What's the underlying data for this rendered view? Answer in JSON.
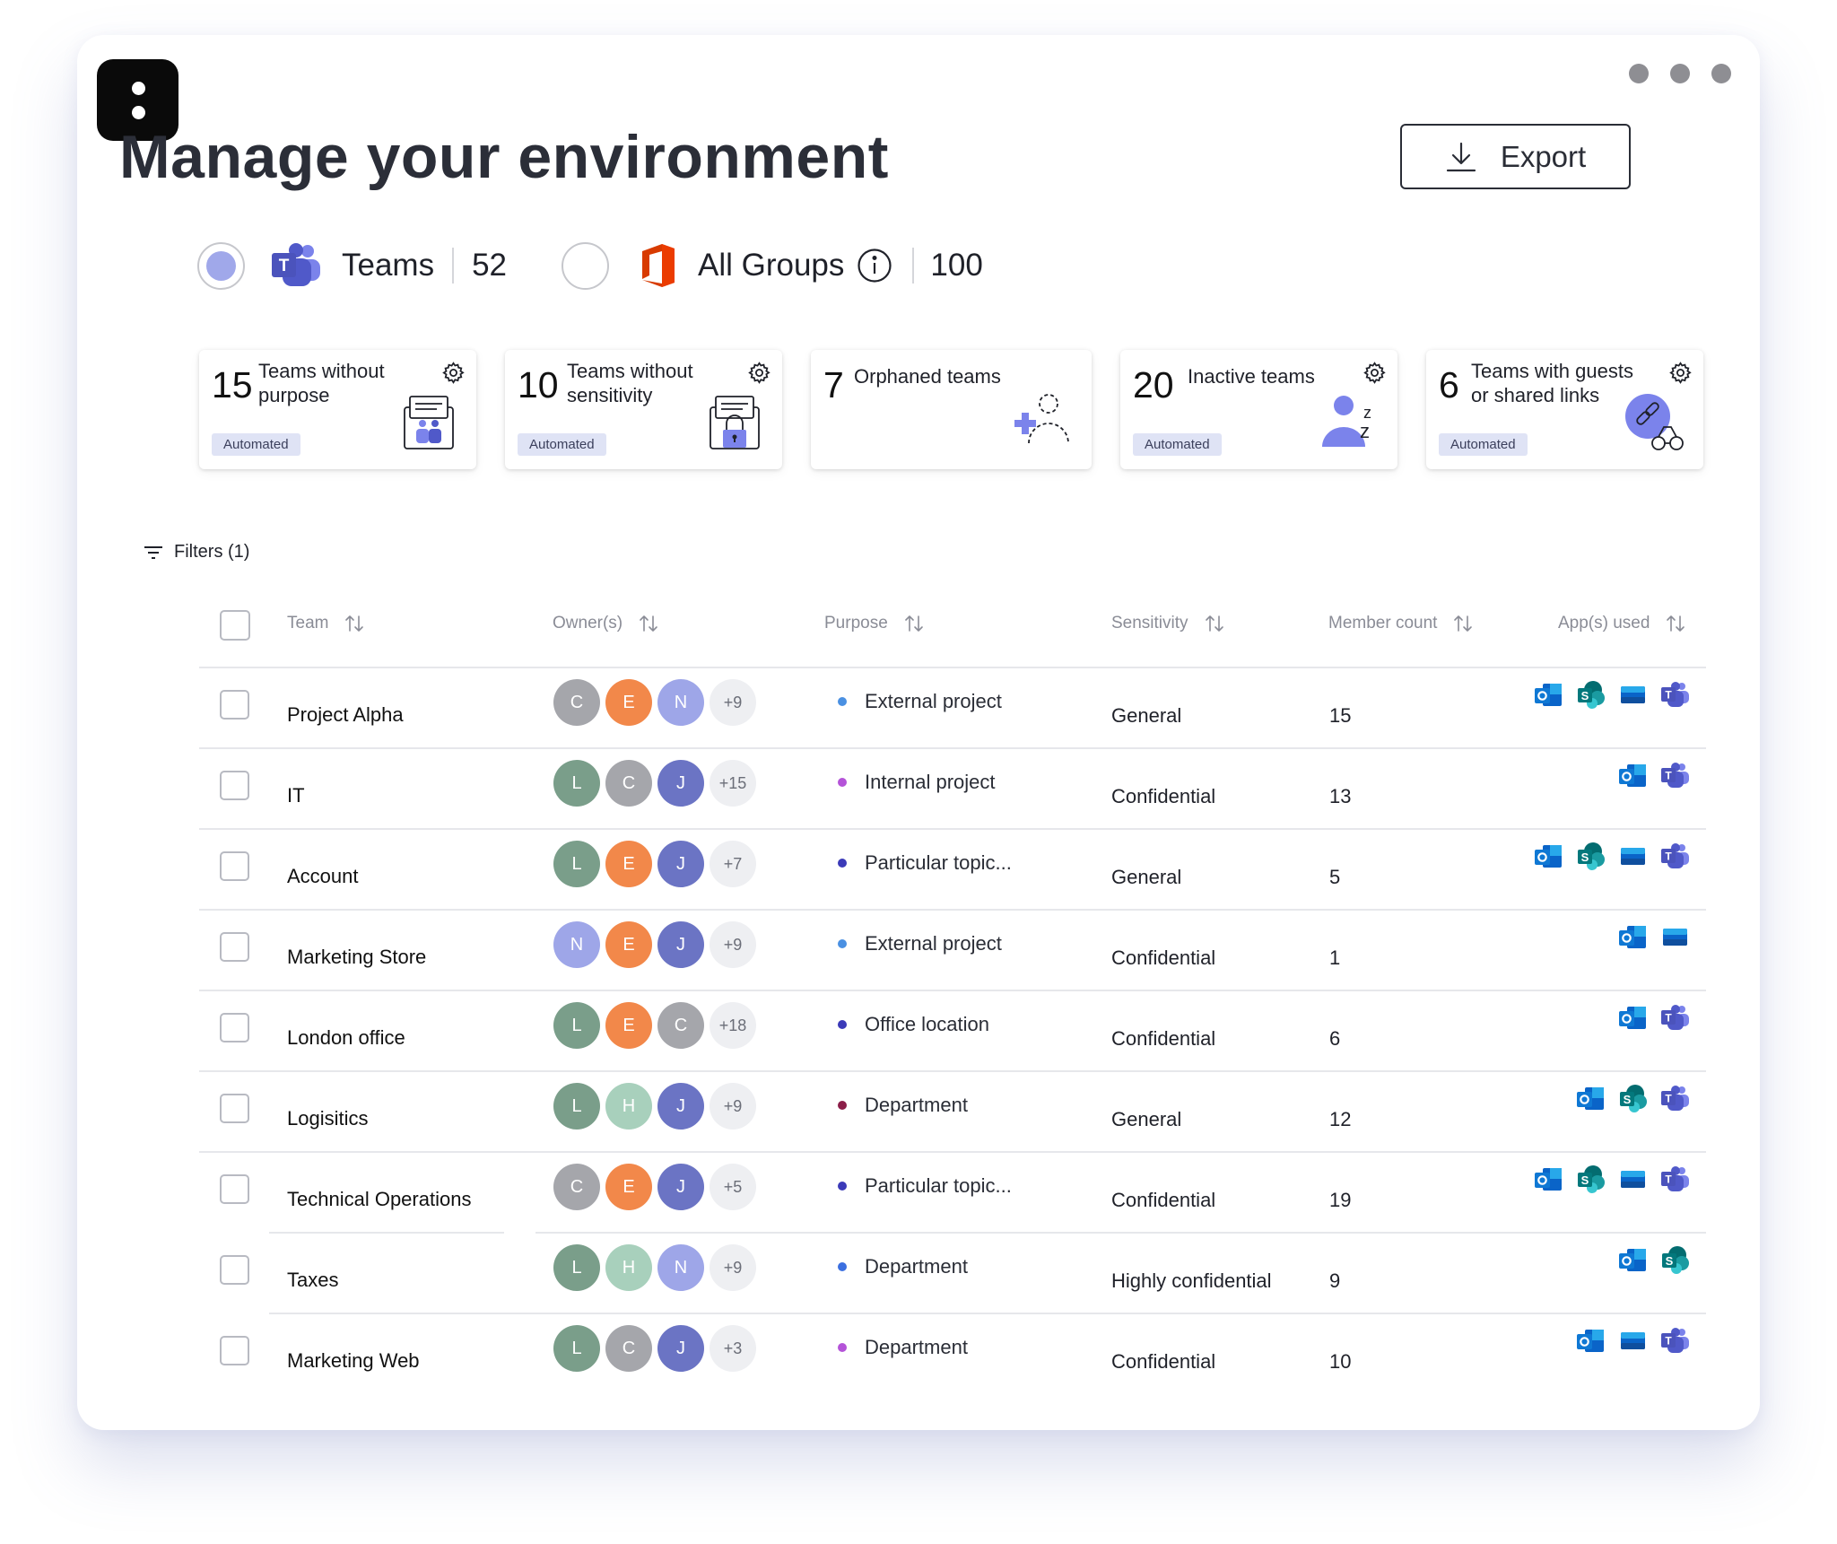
{
  "title": "Manage your environment",
  "export_label": "Export",
  "scope": {
    "teams": {
      "label": "Teams",
      "count": "52",
      "selected": true
    },
    "groups": {
      "label": "All Groups",
      "count": "100",
      "selected": false
    }
  },
  "cards": [
    {
      "count": "15",
      "title": "Teams without\npurpose",
      "badge": "Automated",
      "illustration": "teams-purpose-illustration"
    },
    {
      "count": "10",
      "title": "Teams without\nsensitivity",
      "badge": "Automated",
      "illustration": "teams-lock-illustration"
    },
    {
      "count": "7",
      "title": "Orphaned teams",
      "badge": "",
      "illustration": "orphaned-user-illustration"
    },
    {
      "count": "20",
      "title": "Inactive teams",
      "badge": "Automated",
      "illustration": "sleeping-user-illustration"
    },
    {
      "count": "6",
      "title": "Teams with guests\nor shared links",
      "badge": "Automated",
      "illustration": "link-guest-illustration"
    }
  ],
  "filters_label": "Filters (1)",
  "columns": [
    "Team",
    "Owner(s)",
    "Purpose",
    "Sensitivity",
    "Member count",
    "App(s) used"
  ],
  "rows": [
    {
      "team": "Project Alpha",
      "owners": [
        "C",
        "E",
        "N"
      ],
      "owner_colors": [
        "#a5a6ab",
        "#f2884a",
        "#9ea6e8"
      ],
      "more": "+9",
      "purpose": "External project",
      "purpose_color": "#4a90e2",
      "sensitivity": "General",
      "members": "15",
      "apps": [
        "outlook",
        "sharepoint",
        "exchange",
        "teams"
      ]
    },
    {
      "team": "IT",
      "owners": [
        "L",
        "C",
        "J"
      ],
      "owner_colors": [
        "#7a9e8a",
        "#a5a6ab",
        "#6b74c4"
      ],
      "more": "+15",
      "purpose": "Internal project",
      "purpose_color": "#b453d8",
      "sensitivity": "Confidential",
      "members": "13",
      "apps": [
        "outlook",
        "teams"
      ]
    },
    {
      "team": "Account",
      "owners": [
        "L",
        "E",
        "J"
      ],
      "owner_colors": [
        "#7a9e8a",
        "#f2884a",
        "#6b74c4"
      ],
      "more": "+7",
      "purpose": "Particular topic...",
      "purpose_color": "#3b3ab8",
      "sensitivity": "General",
      "members": "5",
      "apps": [
        "outlook",
        "sharepoint",
        "exchange",
        "teams"
      ]
    },
    {
      "team": "Marketing Store",
      "owners": [
        "N",
        "E",
        "J"
      ],
      "owner_colors": [
        "#9ea6e8",
        "#f2884a",
        "#6b74c4"
      ],
      "more": "+9",
      "purpose": "External project",
      "purpose_color": "#4a90e2",
      "sensitivity": "Confidential",
      "members": "1",
      "apps": [
        "outlook",
        "exchange"
      ]
    },
    {
      "team": "London office",
      "owners": [
        "L",
        "E",
        "C"
      ],
      "owner_colors": [
        "#7a9e8a",
        "#f2884a",
        "#a5a6ab"
      ],
      "more": "+18",
      "purpose": "Office location",
      "purpose_color": "#3b3ab8",
      "sensitivity": "Confidential",
      "members": "6",
      "apps": [
        "outlook",
        "teams"
      ]
    },
    {
      "team": "Logisitics",
      "owners": [
        "L",
        "H",
        "J"
      ],
      "owner_colors": [
        "#7a9e8a",
        "#a8d0bc",
        "#6b74c4"
      ],
      "more": "+9",
      "purpose": "Department",
      "purpose_color": "#8b1e48",
      "sensitivity": "General",
      "members": "12",
      "apps": [
        "outlook",
        "sharepoint",
        "teams"
      ]
    },
    {
      "team": "Technical Operations",
      "owners": [
        "C",
        "E",
        "J"
      ],
      "owner_colors": [
        "#a5a6ab",
        "#f2884a",
        "#6b74c4"
      ],
      "more": "+5",
      "purpose": "Particular topic...",
      "purpose_color": "#3b3ab8",
      "sensitivity": "Confidential",
      "members": "19",
      "apps": [
        "outlook",
        "sharepoint",
        "exchange",
        "teams"
      ]
    },
    {
      "team": "Taxes",
      "owners": [
        "L",
        "H",
        "N"
      ],
      "owner_colors": [
        "#7a9e8a",
        "#a8d0bc",
        "#9ea6e8"
      ],
      "more": "+9",
      "purpose": "Department",
      "purpose_color": "#3b6fe0",
      "sensitivity": "Highly confidential",
      "members": "9",
      "apps": [
        "outlook",
        "sharepoint"
      ]
    },
    {
      "team": "Marketing Web",
      "owners": [
        "L",
        "C",
        "J"
      ],
      "owner_colors": [
        "#7a9e8a",
        "#a5a6ab",
        "#6b74c4"
      ],
      "more": "+3",
      "purpose": "Department",
      "purpose_color": "#b453d8",
      "sensitivity": "Confidential",
      "members": "10",
      "apps": [
        "outlook",
        "exchange",
        "teams"
      ]
    }
  ]
}
